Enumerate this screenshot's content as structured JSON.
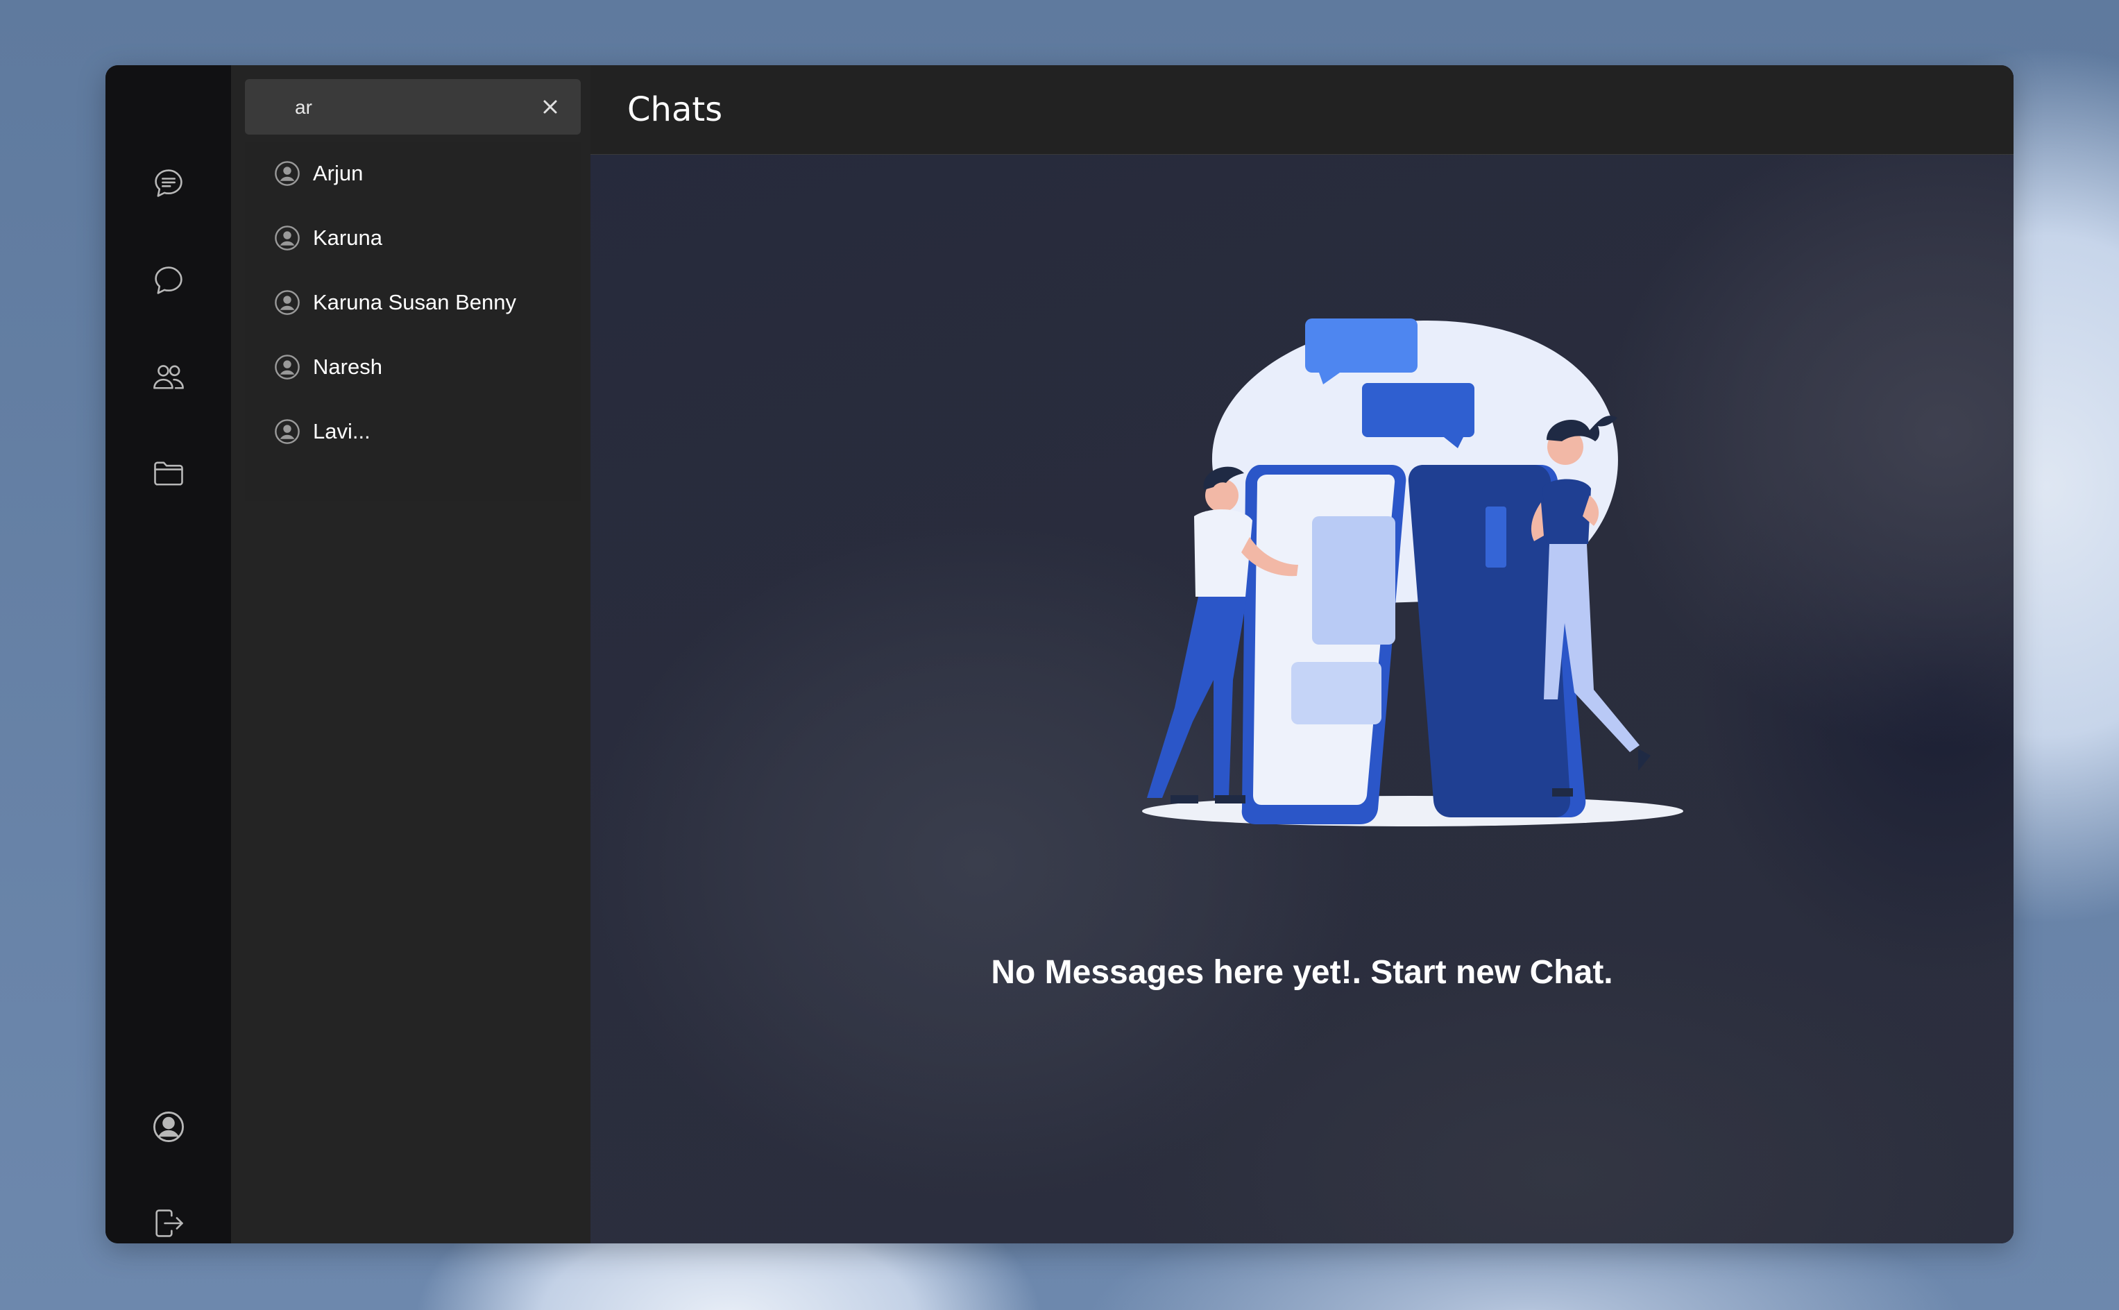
{
  "app": {
    "header_title": "Chats"
  },
  "rail": {
    "items": [
      {
        "name": "chats",
        "icon": "chat-lines-icon"
      },
      {
        "name": "messages",
        "icon": "chat-bubble-icon"
      },
      {
        "name": "contacts",
        "icon": "people-icon"
      },
      {
        "name": "files",
        "icon": "folder-icon"
      }
    ],
    "bottom_items": [
      {
        "name": "profile",
        "icon": "user-circle-icon"
      },
      {
        "name": "logout",
        "icon": "logout-icon"
      }
    ]
  },
  "search": {
    "value": "ar",
    "clear_icon": "close-icon"
  },
  "results": [
    {
      "name": "Arjun"
    },
    {
      "name": "Karuna"
    },
    {
      "name": "Karuna Susan Benny"
    },
    {
      "name": "Naresh"
    },
    {
      "name": "Lavi..."
    }
  ],
  "empty_state": {
    "message": "No Messages here yet!. Start new Chat."
  },
  "colors": {
    "rail_bg": "#111113",
    "sidebar_bg": "#242424",
    "search_bg": "#3a3a3a",
    "accent_blue": "#4a86f0",
    "dark_blue": "#1e3f8a"
  }
}
